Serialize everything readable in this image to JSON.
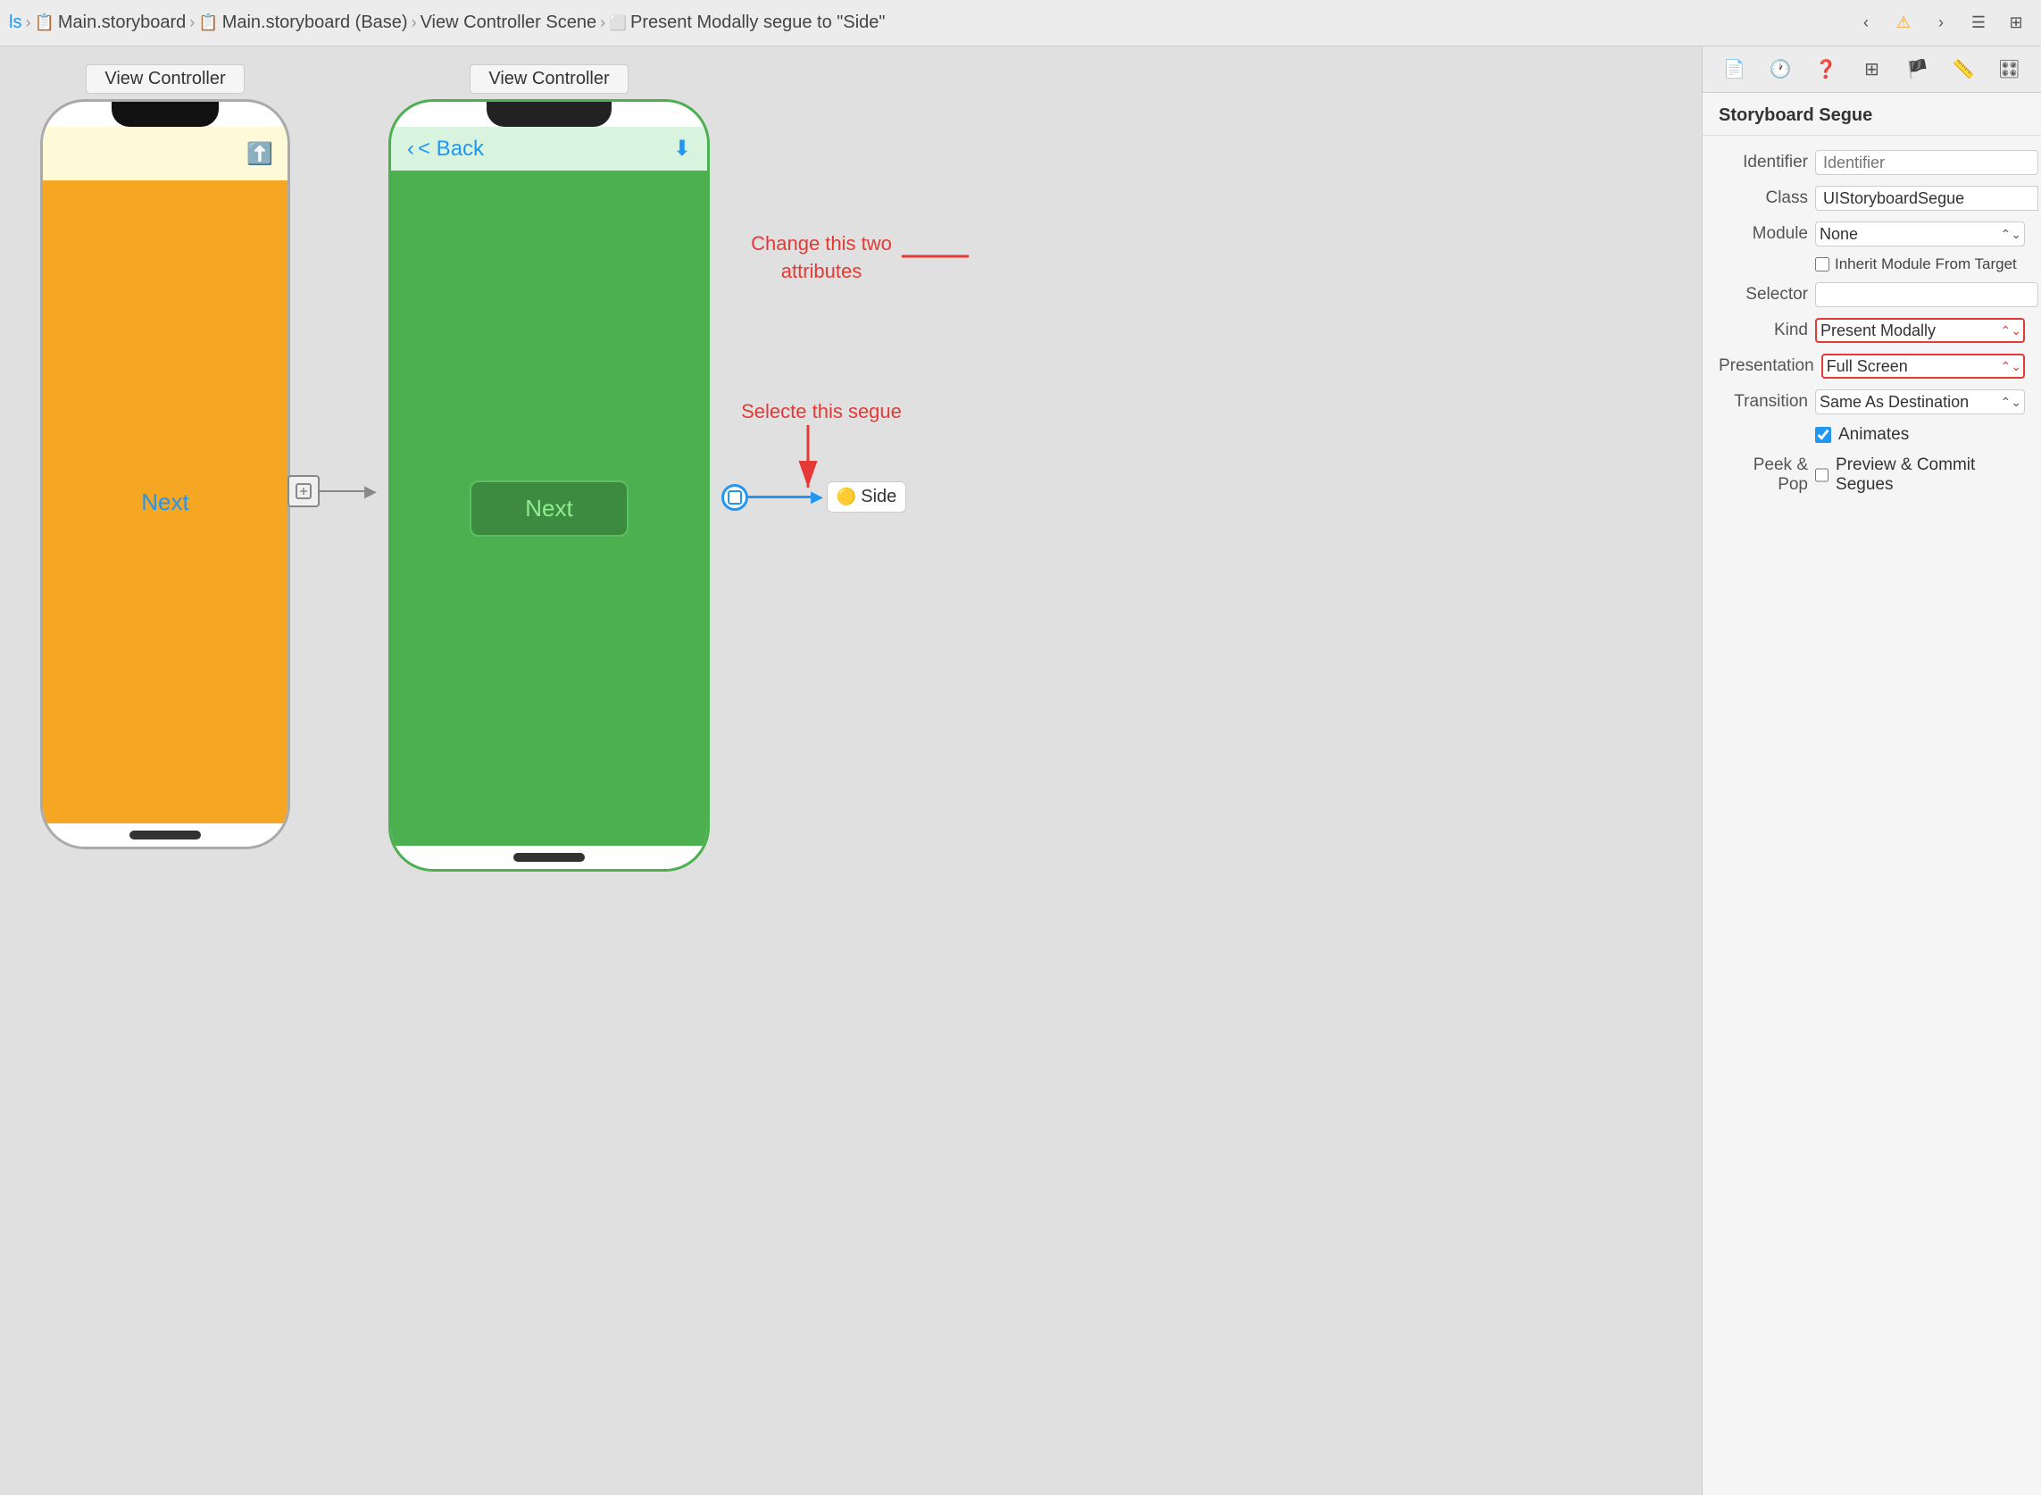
{
  "toolbar": {
    "breadcrumbs": [
      {
        "label": "ls",
        "icon": "folder"
      },
      {
        "label": "Main.storyboard",
        "icon": "storyboard"
      },
      {
        "label": "Main.storyboard (Base)",
        "icon": "storyboard"
      },
      {
        "label": "View Controller Scene",
        "icon": "scene"
      },
      {
        "label": "Present Modally segue to \"Side\"",
        "icon": "segue"
      }
    ],
    "buttons": [
      "back-arrow",
      "warning-icon",
      "forward-arrow",
      "menu-lines",
      "square-grid"
    ]
  },
  "inspector_toolbar_buttons": [
    "doc-icon",
    "clock-icon",
    "question-icon",
    "grid-icon",
    "flag-icon",
    "ruler-icon",
    "slider-icon"
  ],
  "canvas": {
    "vc1_label": "View Controller",
    "vc2_label": "View Controller",
    "next_label": "Next",
    "next_btn": "Next",
    "back_btn": "< Back",
    "side_badge": "Side",
    "annotation1": "Change this two\nattributes",
    "annotation2": "Selecte this segue"
  },
  "inspector": {
    "title": "Storyboard Segue",
    "rows": [
      {
        "label": "Identifier",
        "type": "input",
        "value": "",
        "placeholder": "Identifier"
      },
      {
        "label": "Class",
        "type": "class",
        "value": "UIStoryboardSegue"
      },
      {
        "label": "Module",
        "type": "select",
        "value": "None"
      },
      {
        "label": "Inherit Module From Target",
        "type": "checkbox_inline",
        "checked": false
      },
      {
        "label": "Selector",
        "type": "input",
        "value": "",
        "placeholder": ""
      },
      {
        "label": "Kind",
        "type": "select",
        "value": "Present Modally",
        "highlighted": true
      },
      {
        "label": "Presentation",
        "type": "select",
        "value": "Full Screen",
        "highlighted": true
      },
      {
        "label": "Transition",
        "type": "select",
        "value": "Same As Destination",
        "highlighted": false
      },
      {
        "label": "Animates",
        "type": "checkbox",
        "checked": true
      },
      {
        "label": "Peek & Pop",
        "type": "checkbox_text",
        "checked": false,
        "text": "Preview & Commit Segues"
      }
    ]
  }
}
